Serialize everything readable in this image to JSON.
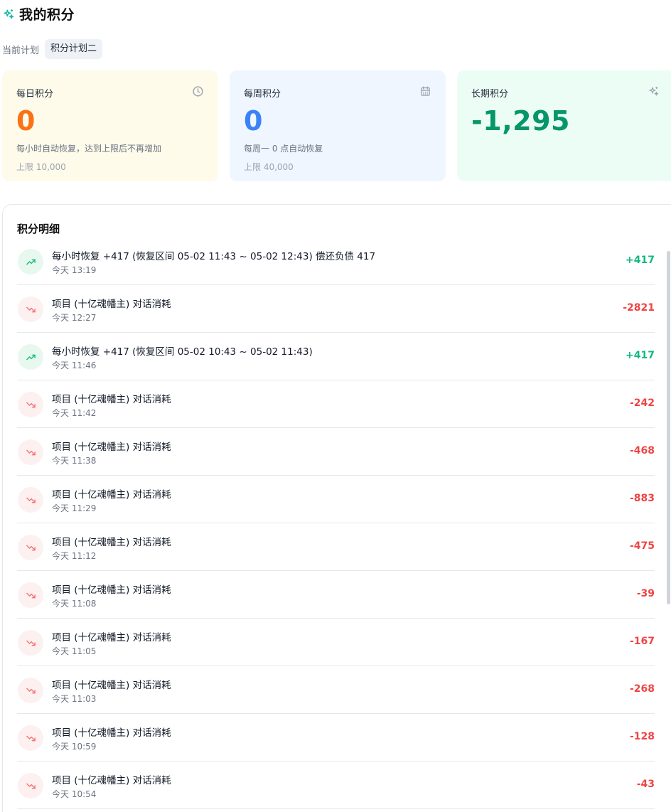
{
  "header": {
    "title": "我的积分",
    "icon": "sparkles-icon"
  },
  "plan": {
    "label": "当前计划",
    "value": "积分计划二"
  },
  "cards": {
    "daily": {
      "title": "每日积分",
      "icon": "clock-icon",
      "value": "0",
      "desc": "每小时自动恢复，达到上限后不再增加",
      "limit": "上限 10,000",
      "color": "#f97316"
    },
    "weekly": {
      "title": "每周积分",
      "icon": "calendar-icon",
      "value": "0",
      "desc": "每周一 0 点自动恢复",
      "limit": "上限 40,000",
      "color": "#3b82f6"
    },
    "long": {
      "title": "长期积分",
      "icon": "sparkles-icon",
      "value": "-1,295",
      "color": "#059669"
    }
  },
  "detail": {
    "title": "积分明细",
    "rows": [
      {
        "type": "up",
        "text": "每小时恢复 +417 (恢复区间 05-02 11:43 ~ 05-02 12:43) 偿还负债 417",
        "time": "今天 13:19",
        "amount": "+417"
      },
      {
        "type": "down",
        "text": "项目 (十亿魂幡主) 对话消耗",
        "time": "今天 12:27",
        "amount": "-2821"
      },
      {
        "type": "up",
        "text": "每小时恢复 +417 (恢复区间 05-02 10:43 ~ 05-02 11:43)",
        "time": "今天 11:46",
        "amount": "+417"
      },
      {
        "type": "down",
        "text": "项目 (十亿魂幡主) 对话消耗",
        "time": "今天 11:42",
        "amount": "-242"
      },
      {
        "type": "down",
        "text": "项目 (十亿魂幡主) 对话消耗",
        "time": "今天 11:38",
        "amount": "-468"
      },
      {
        "type": "down",
        "text": "项目 (十亿魂幡主) 对话消耗",
        "time": "今天 11:29",
        "amount": "-883"
      },
      {
        "type": "down",
        "text": "项目 (十亿魂幡主) 对话消耗",
        "time": "今天 11:12",
        "amount": "-475"
      },
      {
        "type": "down",
        "text": "项目 (十亿魂幡主) 对话消耗",
        "time": "今天 11:08",
        "amount": "-39"
      },
      {
        "type": "down",
        "text": "项目 (十亿魂幡主) 对话消耗",
        "time": "今天 11:05",
        "amount": "-167"
      },
      {
        "type": "down",
        "text": "项目 (十亿魂幡主) 对话消耗",
        "time": "今天 11:03",
        "amount": "-268"
      },
      {
        "type": "down",
        "text": "项目 (十亿魂幡主) 对话消耗",
        "time": "今天 10:59",
        "amount": "-128"
      },
      {
        "type": "down",
        "text": "项目 (十亿魂幡主) 对话消耗",
        "time": "今天 10:54",
        "amount": "-43"
      }
    ]
  },
  "colors": {
    "positive": "#10b981",
    "negative": "#ef4444",
    "accent": "#14b8a6"
  }
}
